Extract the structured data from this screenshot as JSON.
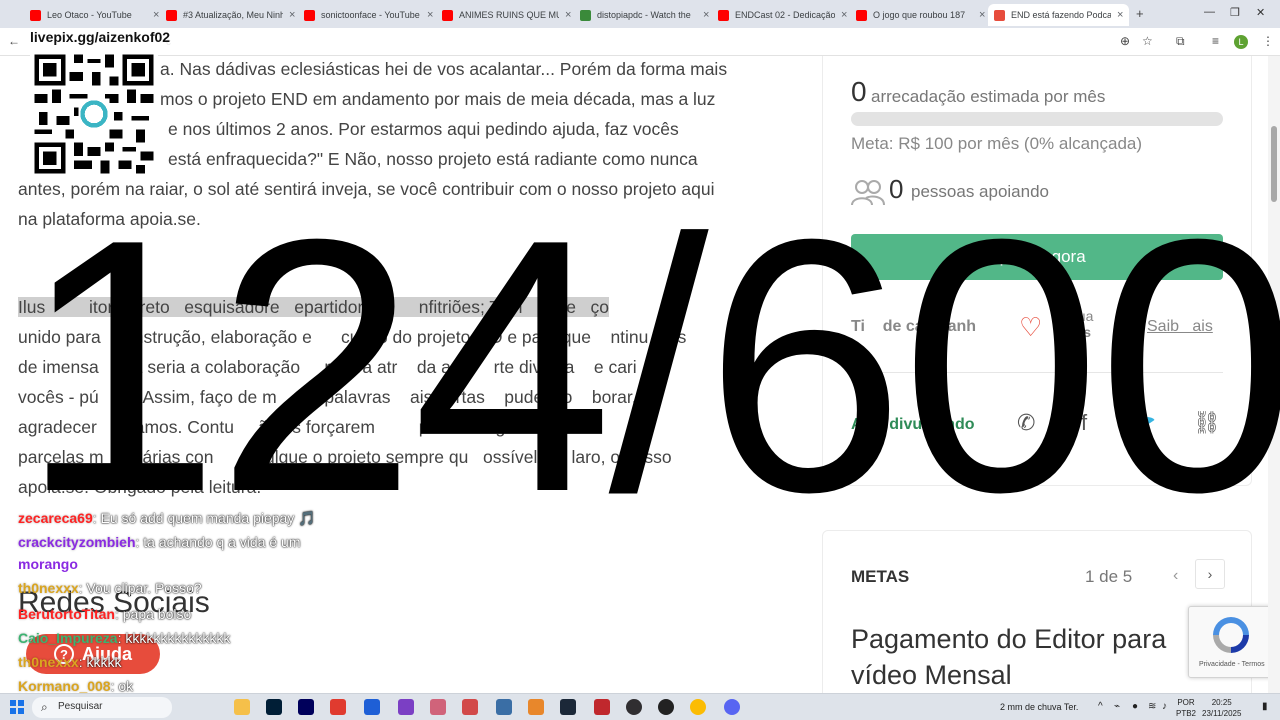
{
  "browser": {
    "tabs": [
      {
        "title": "Leo Otaco - YouTube",
        "color": "#ff0000"
      },
      {
        "title": "#3 Atualização, Meu Ninho",
        "color": "#ff0000"
      },
      {
        "title": "sonictoonface - YouTube",
        "color": "#ff0000"
      },
      {
        "title": "ANIMES RUINS QUE MU",
        "color": "#ff0000"
      },
      {
        "title": "distopiapdc - Watch the",
        "color": "#3a8a3a"
      },
      {
        "title": "ENDCast 02 - Dedicação",
        "color": "#ff0000"
      },
      {
        "title": "O jogo que roubou 187",
        "color": "#ff0000"
      },
      {
        "title": "END está fazendo Podcas",
        "color": "#e74c3c"
      }
    ],
    "address_tail": "c",
    "profile_initial": "L"
  },
  "overlay": {
    "url": "livepix.gg/aizenkof02",
    "counter": "124/600",
    "chat": [
      {
        "user": "zecareca69",
        "msg": ": Eu só add quem manda piepay 🎵",
        "color": "#ff2222"
      },
      {
        "user": "crackcityzombieh",
        "msg": ": ta achando q a vida é um",
        "color": "#8a2be2"
      },
      {
        "user": "",
        "msg": "morango",
        "color": "#8a2be2"
      },
      {
        "user": "th0nexxx",
        "msg": ": Vou clipar. Posso?",
        "color": "#daa520"
      },
      {
        "user": "BerutortoTitan",
        "msg": ": papa bolso",
        "color": "#ff2222"
      },
      {
        "user": "Caio_Impureza",
        "msg": ": kkkkkkkkkkkkkkk",
        "color": "#3cb371"
      },
      {
        "user": "th0nexxx",
        "msg": ": kkkkk",
        "color": "#daa520"
      },
      {
        "user": "Kormano_008",
        "msg": ": ok",
        "color": "#daa520"
      }
    ]
  },
  "article": {
    "p1_lines": [
      "a. Nas dádivas eclesiásticas hei de vos acalantar... Porém da forma mais",
      "mos o projeto END em andamento por mais de meia década, mas a luz",
      "e nos últimos 2 anos. Por estarmos aqui pedindo ajuda, faz vocês",
      "está enfraquecida?\" E Não, nosso projeto está radiante como nunca",
      "antes, porém na raiar, o sol até sentirá inveja, se você contribuir com o nosso projeto aqui",
      "na plataforma apoia.se."
    ],
    "p2_lines": [
      "Ilus         itor; Direto   esquisadore   epartidor Pú      nfitriões; Tem   um e   ço",
      "unido para   construção, elaboração e      cução do projeto    D e para que    ntinu    os",
      "de imensa     da seria a colaboração     nceira atr    da a ja     rte divulga    e cari",
      "vocês - pú    o - Assim, faço de m     as palavras    ais curtas    puder co    borar,",
      "agradecer    s-iamos. Contu     ão os forçarem         puder    signar ess",
      "parcelas m     etárias con      divulgue o projeto sempre qu   ossível e    laro, o nosso",
      "apoia.se. Obrigado pela leitura."
    ],
    "redes_title": "Redes Sociais",
    "help_label": "Ajuda",
    "help_icon": "question-icon"
  },
  "campaign": {
    "amount": "0",
    "amount_label": "arrecadação estimada por mês",
    "progress_pct": 0,
    "goal_text": "Meta: R$ 100 por mês (0% alcançada)",
    "supporters_count": "0",
    "supporters_label": "pessoas apoiando",
    "support_button": "Apoiar agora",
    "type_label": "Ti    de campanh",
    "continua_line1": "tinua",
    "continua_line2": "mês",
    "saiba_label": "Saib   ais",
    "share_label": "Aj     divulgando",
    "accent": "#52b788"
  },
  "metas": {
    "title": "METAS",
    "page_indicator": "1 de 5",
    "prev": "‹",
    "next": "›",
    "goal_title": "Pagamento do Editor para vídeo Mensal"
  },
  "recaptcha": {
    "text": "Privacidade - Termos"
  },
  "taskbar": {
    "search_placeholder": "Pesquisar",
    "weather": "2 mm de chuva Ter.",
    "lang_line1": "POR",
    "lang_line2": "PTB2",
    "time": "20:25",
    "date": "23/11/2025"
  }
}
